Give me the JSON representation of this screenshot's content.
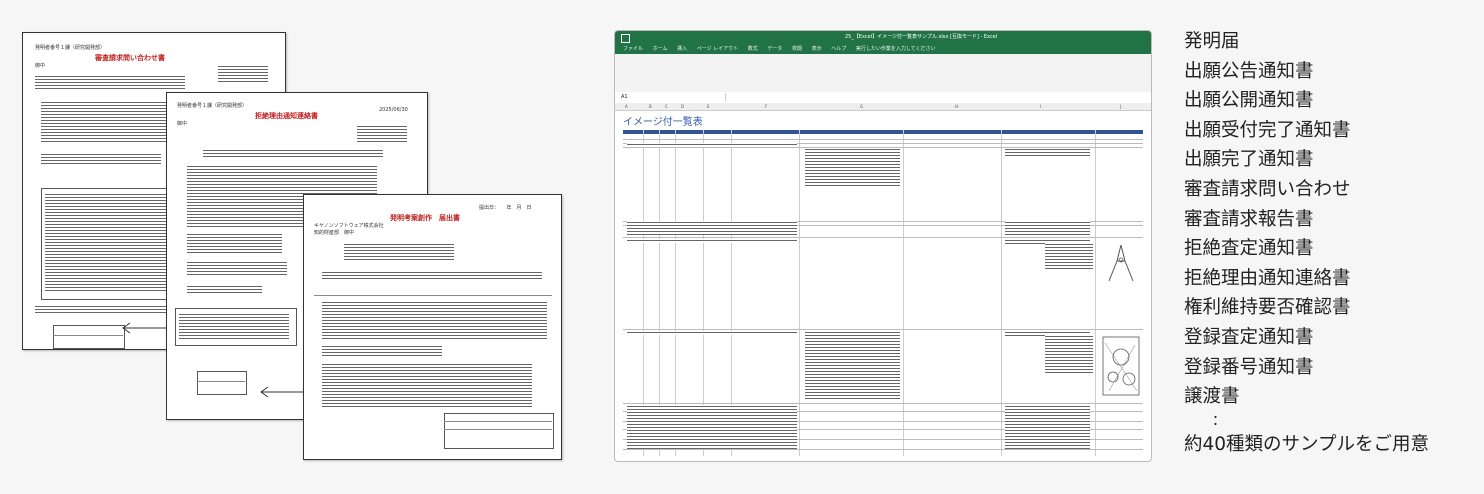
{
  "docs": {
    "doc1": {
      "title": "審査請求問い合わせ書",
      "header": "発明者番号１課（研究開発部）",
      "date": "",
      "to": "御中"
    },
    "doc2": {
      "title": "拒絶理由通知連絡書",
      "header": "発明者番号１課（研究開発部）",
      "date": "2025/06/30",
      "to": "御中"
    },
    "doc3": {
      "title": "発明考案創作　届出書",
      "header": "提出日：　　年　月　日",
      "company": "キヤノンソフトウェア株式会社",
      "to": "知的財産部　御中"
    }
  },
  "excel": {
    "window_title": "25_【Excel】イメージ付一覧表サンプル.xlsx [互換モード] - Excel",
    "menu": [
      "ファイル",
      "ホーム",
      "挿入",
      "ページ レイアウト",
      "数式",
      "データ",
      "校閲",
      "表示",
      "ヘルプ",
      "実行したい作業を入力してください"
    ],
    "cell_ref": "A1",
    "columns": [
      "A",
      "B",
      "C",
      "D",
      "E",
      "F",
      "G",
      "H",
      "I",
      "J"
    ],
    "sheet_title": "イメージ付一覧表"
  },
  "list": {
    "items": [
      "発明届",
      "出願公告通知書",
      "出願公開通知書",
      "出願受付完了通知書",
      "出願完了通知書",
      "審査請求問い合わせ",
      "審査請求報告書",
      "拒絶査定通知書",
      "拒絶理由通知連絡書",
      "権利維持要否確認書",
      "登録査定通知書",
      "登録番号通知書",
      "譲渡書"
    ],
    "dots": "：",
    "footer": "約40種類のサンプルをご用意"
  }
}
